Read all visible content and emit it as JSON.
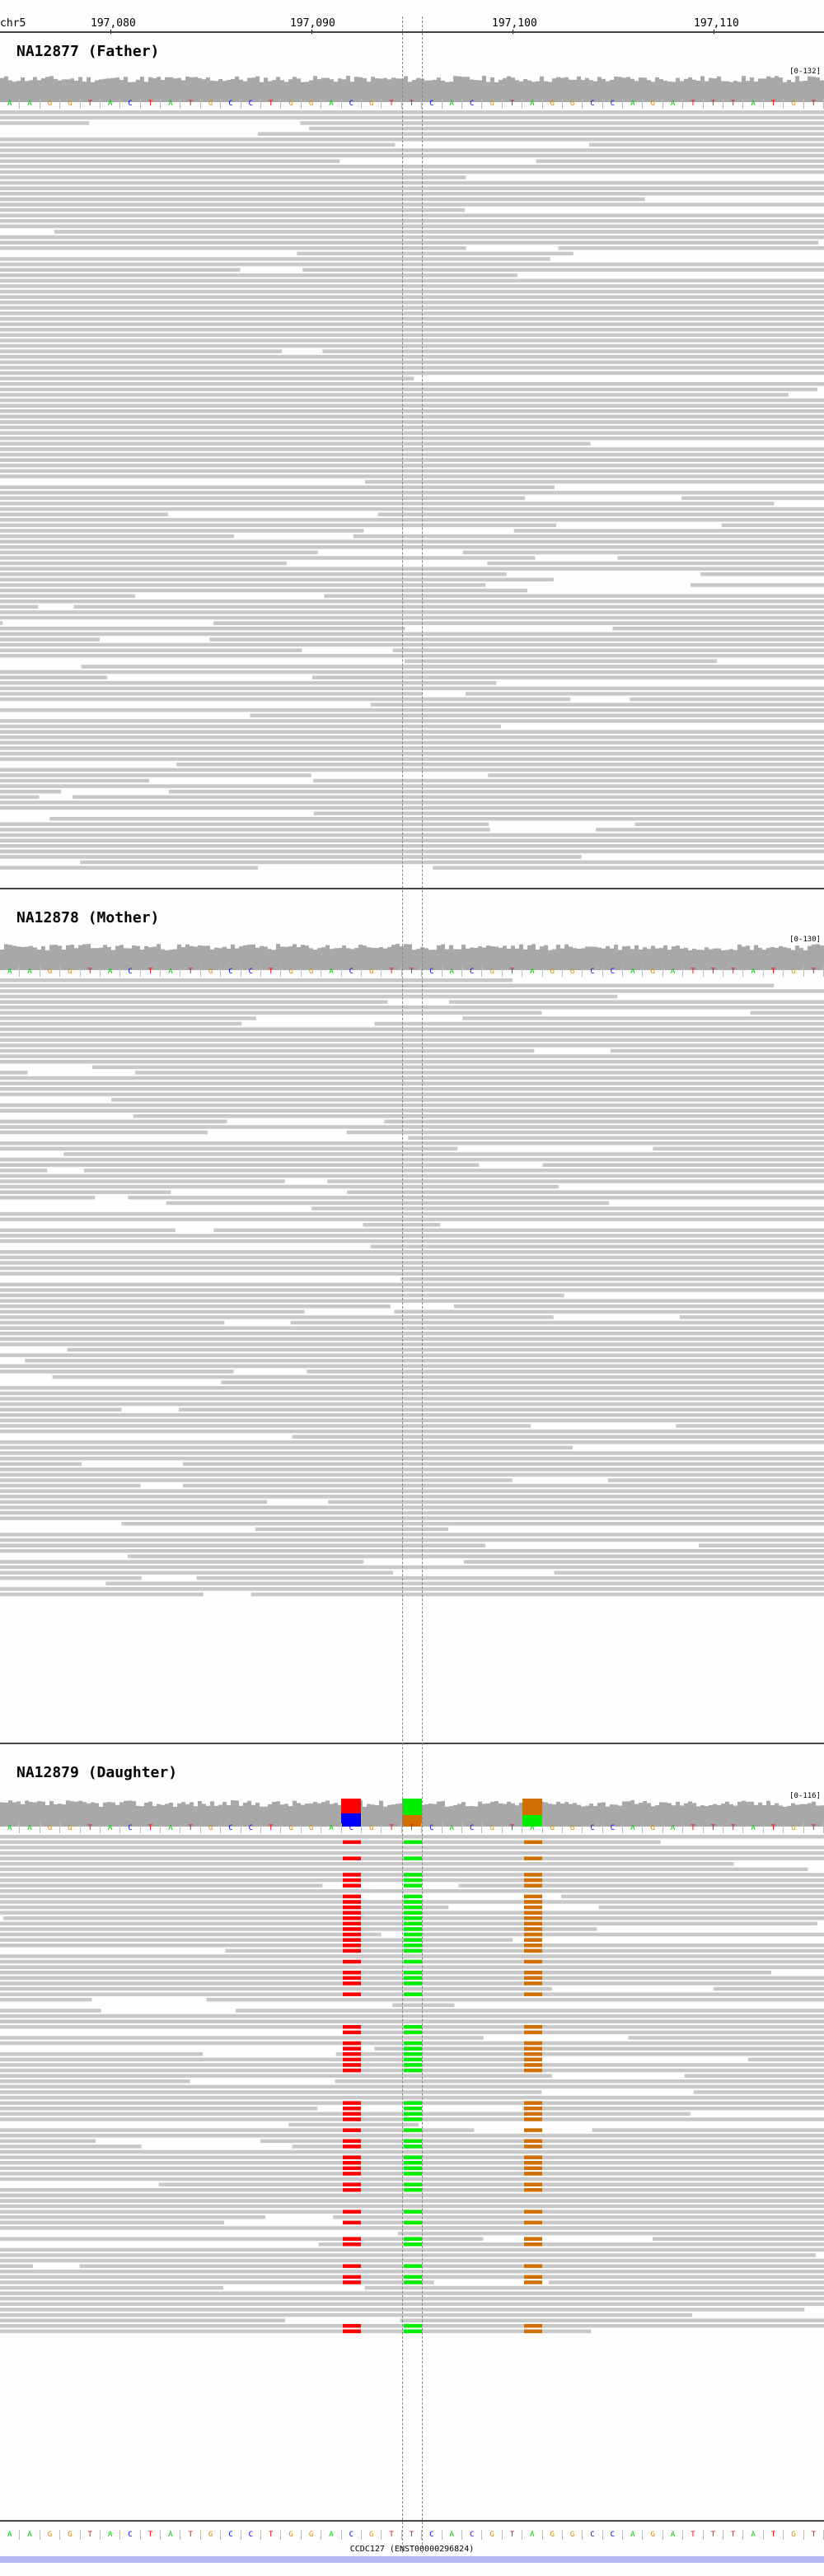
{
  "ruler": {
    "chrom": "chr5",
    "positions": [
      "197,080",
      "197,090",
      "197,100",
      "197,110"
    ]
  },
  "reference_sequence": [
    "A",
    "A",
    "G",
    "G",
    "T",
    "A",
    "C",
    "T",
    "A",
    "T",
    "G",
    "C",
    "C",
    "T",
    "G",
    "G",
    "A",
    "C",
    "G",
    "T",
    "T",
    "C",
    "A",
    "C",
    "G",
    "T",
    "A",
    "G",
    "G",
    "C",
    "C",
    "A",
    "G",
    "A",
    "T",
    "T",
    "T",
    "A",
    "T",
    "G",
    "T"
  ],
  "base_colors": {
    "A": "#00c800",
    "C": "#0000ff",
    "G": "#d18c00",
    "T": "#ff0000"
  },
  "samples": [
    {
      "title": "NA12877 (Father)",
      "range": "[0-132]"
    },
    {
      "title": "NA12878 (Mother)",
      "range": "[0-130]"
    },
    {
      "title": "NA12879 (Daughter)",
      "range": "[0-116]"
    }
  ],
  "gene": {
    "label": "CCDC127 (ENST00000296824)"
  },
  "colors": {
    "read": "#c8c8c8",
    "coverage": "#a8a8a8",
    "mismatch_T": "#ff0000",
    "mismatch_A": "#00ee00",
    "mismatch_G": "#d17000",
    "mismatch_C": "#8080ff"
  }
}
